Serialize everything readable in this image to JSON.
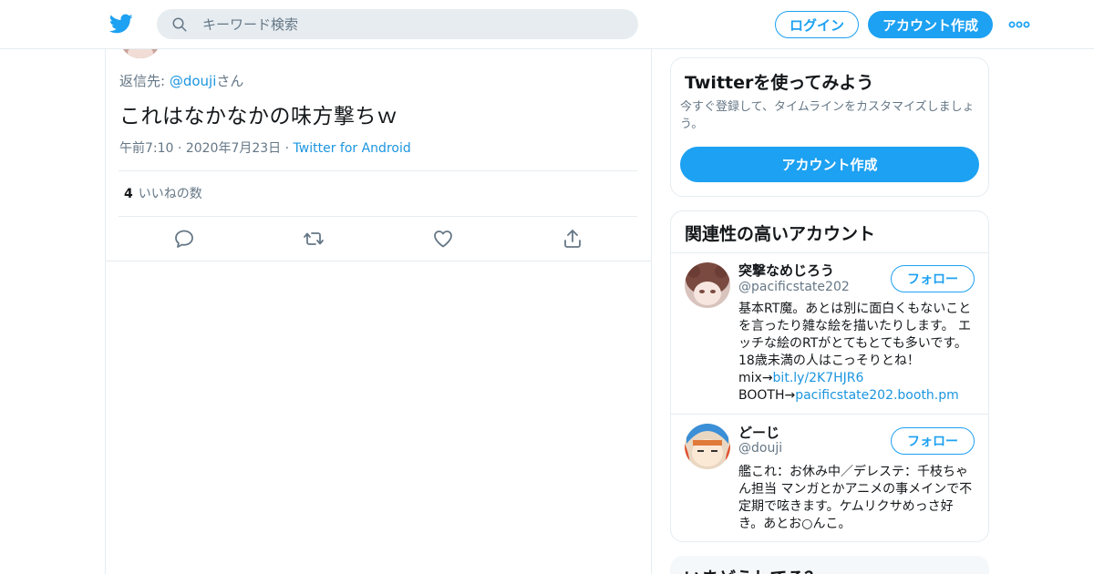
{
  "header": {
    "search_placeholder": "キーワード検索",
    "login_label": "ログイン",
    "signup_label": "アカウント作成",
    "brand_color": "#1da1f2",
    "icons": [
      "twitter-bird-icon",
      "search-icon",
      "more-dots-icon"
    ]
  },
  "tweet": {
    "reply_prefix": "返信先: ",
    "reply_mention": "@douji",
    "reply_suffix": "さん",
    "text": "これはなかなかの味方撃ちｗ",
    "time": "午前7:10",
    "date": "2020年7月23日",
    "source": "Twitter for Android",
    "likes_count": "4",
    "likes_label": "いいねの数",
    "actions": [
      "reply-icon",
      "retweet-icon",
      "like-icon",
      "share-icon"
    ]
  },
  "signup_card": {
    "title": "Twitterを使ってみよう",
    "description": "今すぐ登録して、タイムラインをカスタマイズしましょう。",
    "cta_label": "アカウント作成"
  },
  "related": {
    "title": "関連性の高いアカウント",
    "accounts": [
      {
        "name": "突撃なめじろう",
        "handle": "@pacificstate202",
        "follow_label": "フォロー",
        "bio_line1": "基本RT魔。あとは別に面白くもないことを言ったり雑な絵を描いたりします。 エッチな絵のRTがとてもとても多いです。18歳未満の人はこっそりとね！ mix→",
        "bio_link1": "bit.ly/2K7HJR6",
        "bio_line2": "BOOTH→",
        "bio_link2": "pacificstate202.booth.pm"
      },
      {
        "name": "どーじ",
        "handle": "@douji",
        "follow_label": "フォロー",
        "bio": "艦これ：お休み中／デレステ：千枝ちゃん担当 マンガとかアニメの事メインで不定期で呟きます。ケムリクサめっさ好き。あとお○んこ。"
      }
    ]
  },
  "trends_card": {
    "title": "いまどうしてる？"
  }
}
